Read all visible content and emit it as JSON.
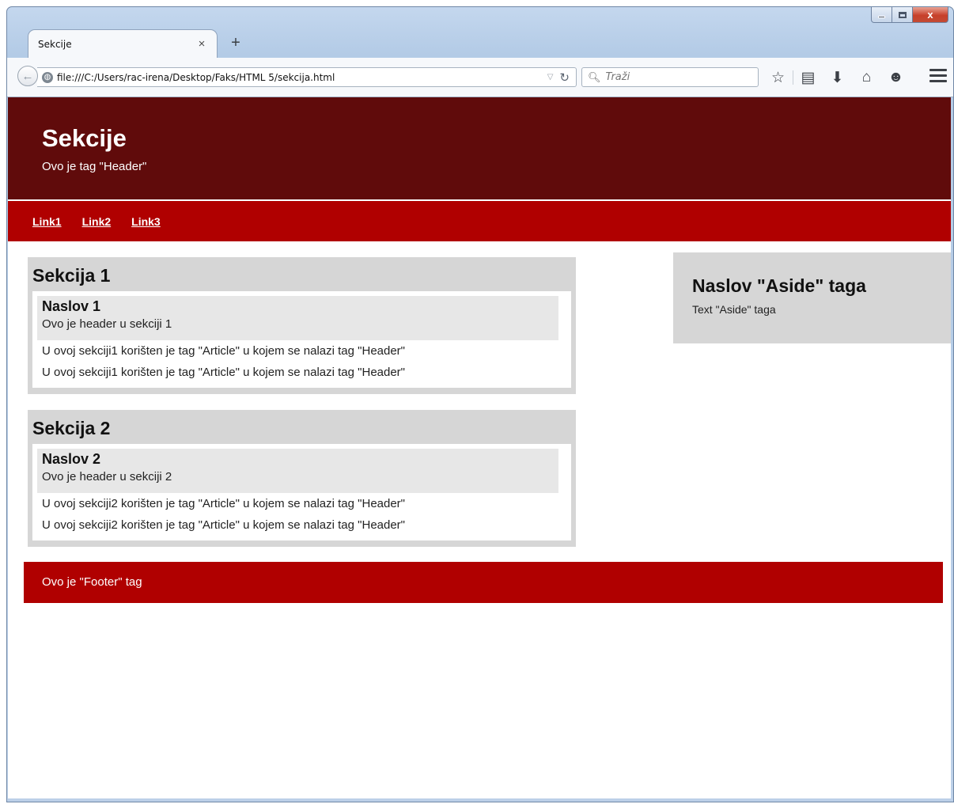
{
  "browser": {
    "tab_title": "Sekcije",
    "tab_close": "×",
    "new_tab": "+",
    "url": "file:///C:/Users/rac-irena/Desktop/Faks/HTML 5/sekcija.html",
    "search_placeholder": "Traži",
    "window_controls": {
      "minimize": "",
      "maximize": "",
      "close": "x"
    },
    "toolbar_icons": [
      "star-icon",
      "reading-list-icon",
      "download-icon",
      "home-icon",
      "chat-icon",
      "hamburger-menu-icon"
    ]
  },
  "page": {
    "header": {
      "title": "Sekcije",
      "subtitle": "Ovo je tag \"Header\""
    },
    "nav": {
      "links": [
        "Link1",
        "Link2",
        "Link3"
      ]
    },
    "sections": [
      {
        "title": "Sekcija 1",
        "article": {
          "heading": "Naslov 1",
          "header_text": "Ovo je header u sekciji 1",
          "lines": [
            "U ovoj sekciji1 korišten je tag \"Article\" u kojem se nalazi tag \"Header\"",
            "U ovoj sekciji1 korišten je tag \"Article\" u kojem se nalazi tag \"Header\""
          ]
        }
      },
      {
        "title": "Sekcija 2",
        "article": {
          "heading": "Naslov 2",
          "header_text": "Ovo je header u sekciji 2",
          "lines": [
            "U ovoj sekciji2 korišten je tag \"Article\" u kojem se nalazi tag \"Header\"",
            "U ovoj sekciji2 korišten je tag \"Article\" u kojem se nalazi tag \"Header\""
          ]
        }
      }
    ],
    "aside": {
      "title": "Naslov \"Aside\" taga",
      "text": "Text \"Aside\" taga"
    },
    "footer": {
      "text": "Ovo je \"Footer\" tag"
    }
  },
  "colors": {
    "header_bg": "#600b0b",
    "nav_bg": "#b00000",
    "footer_bg": "#b00000",
    "section_bg": "#d6d6d6",
    "article_header_bg": "#e7e7e7"
  }
}
